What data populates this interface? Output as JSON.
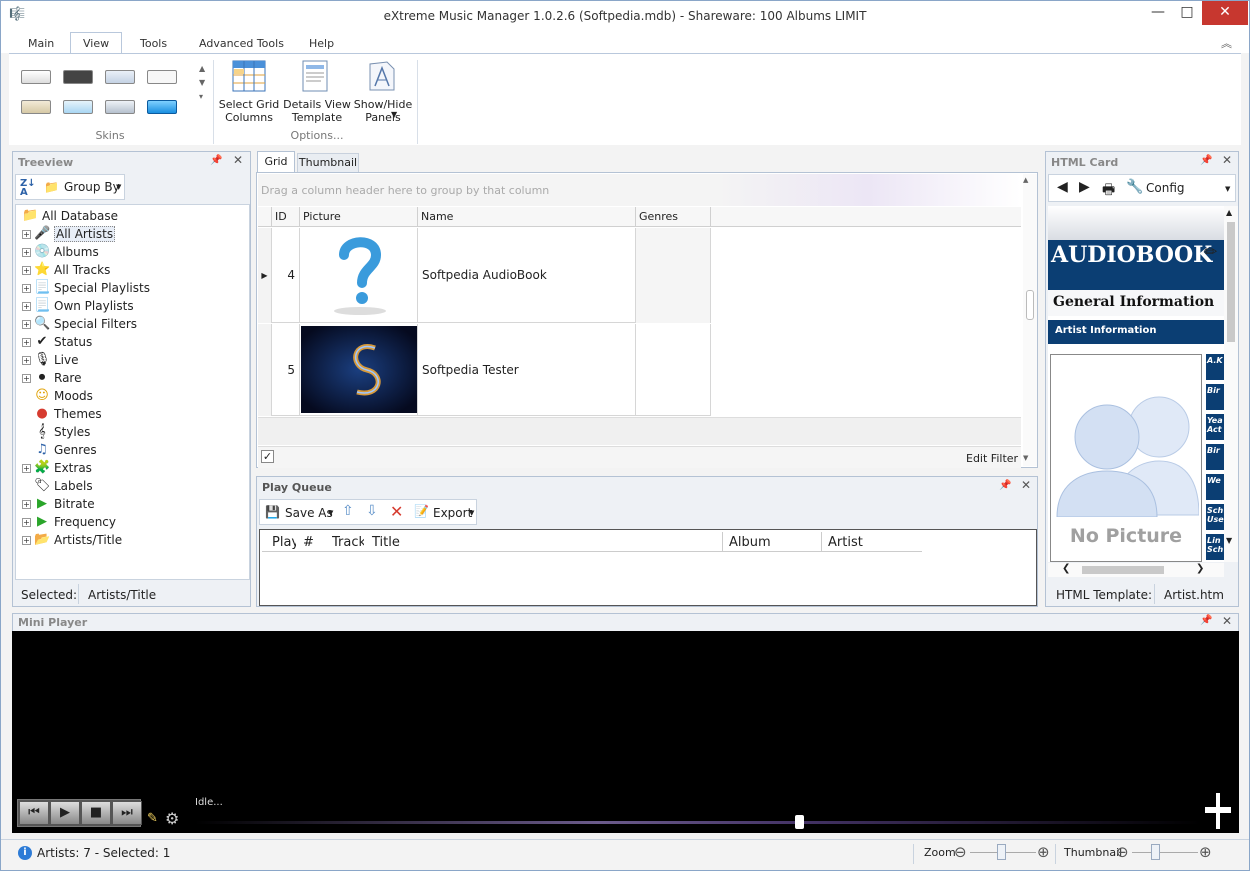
{
  "window": {
    "title": "eXtreme Music Manager 1.0.2.6 (Softpedia.mdb) - Shareware: 100 Albums LIMIT",
    "min": "—",
    "max": "□",
    "close": "✕"
  },
  "ribbon_tabs": [
    "Main",
    "View",
    "Tools",
    "Advanced Tools",
    "Help"
  ],
  "ribbon": {
    "skins_label": "Skins",
    "options_label": "Options...",
    "buttons": [
      {
        "label": "Select Grid Columns",
        "icon": "grid-columns-icon"
      },
      {
        "label": "Details View Template",
        "icon": "template-icon"
      },
      {
        "label": "Show/Hide Panels",
        "icon": "panels-icon"
      }
    ]
  },
  "treeview": {
    "title": "Treeview",
    "group_by": "Group By",
    "items": [
      {
        "label": "All Database",
        "icon": "database-icon",
        "expandable": false
      },
      {
        "label": "All Artists",
        "icon": "microphone-icon",
        "expandable": true,
        "selected": true
      },
      {
        "label": "Albums",
        "icon": "album-icon",
        "expandable": true
      },
      {
        "label": "All Tracks",
        "icon": "star-icon",
        "expandable": true
      },
      {
        "label": "Special Playlists",
        "icon": "playlist-icon",
        "expandable": true
      },
      {
        "label": "Own Playlists",
        "icon": "playlist-icon",
        "expandable": true
      },
      {
        "label": "Special Filters",
        "icon": "filter-icon",
        "expandable": true
      },
      {
        "label": "Status",
        "icon": "check-icon",
        "expandable": true
      },
      {
        "label": "Live",
        "icon": "live-icon",
        "expandable": true
      },
      {
        "label": "Rare",
        "icon": "vinyl-icon",
        "expandable": true
      },
      {
        "label": "Moods",
        "icon": "smiley-icon",
        "expandable": false
      },
      {
        "label": "Themes",
        "icon": "themes-icon",
        "expandable": false
      },
      {
        "label": "Styles",
        "icon": "styles-icon",
        "expandable": false
      },
      {
        "label": "Genres",
        "icon": "note-icon",
        "expandable": false
      },
      {
        "label": "Extras",
        "icon": "extras-icon",
        "expandable": true
      },
      {
        "label": "Labels",
        "icon": "label-icon",
        "expandable": false
      },
      {
        "label": "Bitrate",
        "icon": "play-icon",
        "expandable": true
      },
      {
        "label": "Frequency",
        "icon": "play-icon",
        "expandable": true
      },
      {
        "label": "Artists/Title",
        "icon": "folder-icon",
        "expandable": true
      }
    ],
    "status_label": "Selected:",
    "status_value": "Artists/Title"
  },
  "grid": {
    "tabs": [
      "Grid",
      "Thumbnail"
    ],
    "group_hint": "Drag a column header here to group by that column",
    "columns": [
      "ID",
      "Picture",
      "Name",
      "Genres"
    ],
    "rows": [
      {
        "id": "4",
        "name": "Softpedia AudioBook",
        "genres": ""
      },
      {
        "id": "5",
        "name": "Softpedia Tester",
        "genres": ""
      }
    ],
    "edit_filter": "Edit Filter"
  },
  "play_queue": {
    "title": "Play Queue",
    "save_as": "Save As",
    "export": "Export",
    "columns": [
      "Play",
      "#",
      "Track",
      "Title",
      "Album",
      "Artist"
    ]
  },
  "html_card": {
    "title": "HTML Card",
    "config": "Config",
    "heading": "AUDIOBOOK",
    "section": "General Information",
    "band": "Artist Information",
    "no_picture": "No Picture",
    "side_tabs": [
      "A.K",
      "Bir",
      "Yea Act",
      "Bir",
      "We",
      "Sch Use",
      "Lin Sch"
    ],
    "status_label": "HTML Template:",
    "status_value": "Artist.htm"
  },
  "mini_player": {
    "title": "Mini Player",
    "status": "Idle...",
    "progress": 0.6
  },
  "statusbar": {
    "artists": "Artists: 7 - Selected: 1",
    "zoom": "Zoom",
    "thumbnail": "Thumbnail"
  }
}
